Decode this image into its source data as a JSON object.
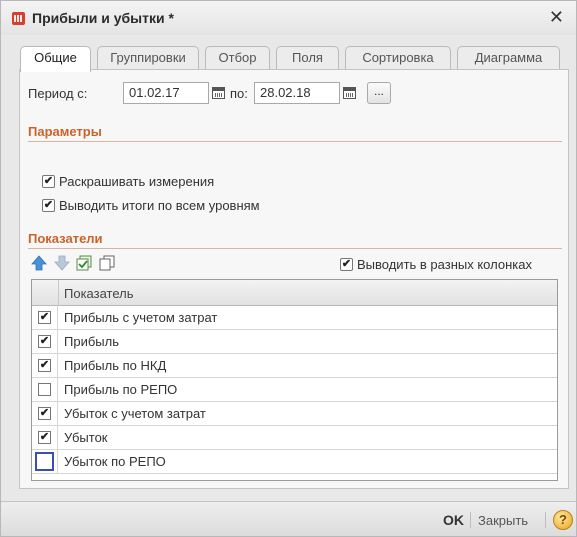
{
  "window": {
    "title": "Прибыли и убытки *"
  },
  "tabs": [
    "Общие",
    "Группировки",
    "Отбор",
    "Поля",
    "Сортировка",
    "Диаграмма"
  ],
  "period": {
    "label_from": "Период с:",
    "from": "01.02.17",
    "label_to": "по:",
    "to": "28.02.18",
    "more": "..."
  },
  "params": {
    "title": "Параметры",
    "color_dims": {
      "label": "Раскрашивать измерения",
      "checked": true
    },
    "totals_all_levels": {
      "label": "Выводить итоги по всем уровням",
      "checked": true
    }
  },
  "indicators": {
    "title": "Показатели",
    "separate_columns": {
      "label": "Выводить в разных колонках",
      "checked": true
    },
    "column_header": "Показатель",
    "rows": [
      {
        "label": "Прибыль с учетом затрат",
        "checked": true
      },
      {
        "label": "Прибыль",
        "checked": true
      },
      {
        "label": "Прибыль по НКД",
        "checked": true
      },
      {
        "label": "Прибыль по РЕПО",
        "checked": false
      },
      {
        "label": "Убыток с учетом затрат",
        "checked": true
      },
      {
        "label": "Убыток",
        "checked": true
      },
      {
        "label": "Убыток по РЕПО",
        "checked": false
      }
    ]
  },
  "footer": {
    "ok": "OK",
    "close": "Закрыть",
    "help": "?"
  },
  "icons": {
    "up": "arrow-up-icon",
    "down": "arrow-down-icon",
    "check_all": "check-all-icon",
    "copy": "copy-icon"
  }
}
